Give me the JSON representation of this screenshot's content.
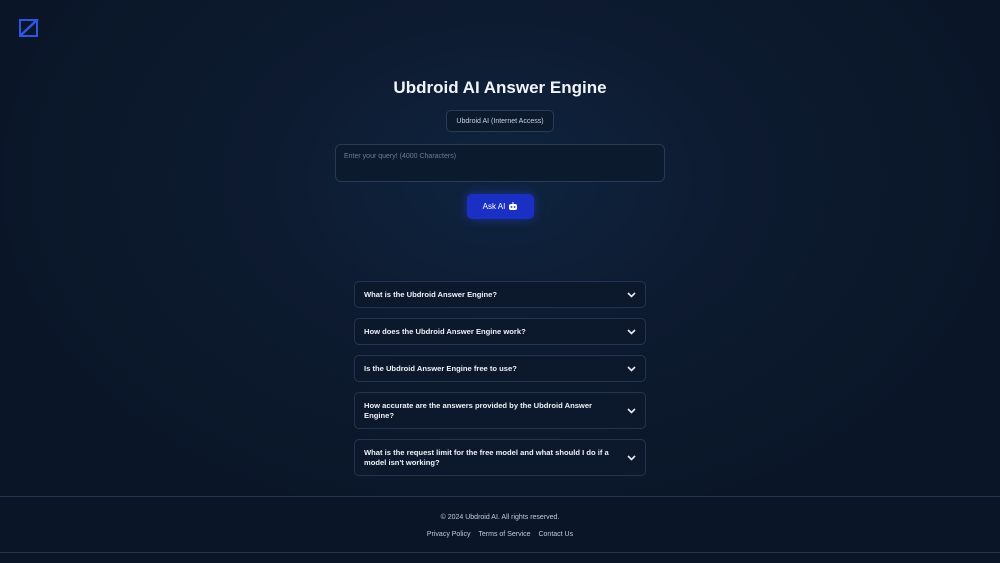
{
  "header": {
    "logo_icon": "logo-icon",
    "title": "Ubdroid AI Answer Engine"
  },
  "form": {
    "model_selected": "Ubdroid AI (Internet Access)",
    "query_placeholder": "Enter your query! (4000 Characters)",
    "ask_label": "Ask AI",
    "ask_icon": "robot-icon",
    "accent_color": "#1a2fc4"
  },
  "faq": [
    {
      "question": "What is the Ubdroid Answer Engine?"
    },
    {
      "question": "How does the Ubdroid Answer Engine work?"
    },
    {
      "question": "Is the Ubdroid Answer Engine free to use?"
    },
    {
      "question": "How accurate are the answers provided by the Ubdroid Answer Engine?"
    },
    {
      "question": "What is the request limit for the free model and what should I do if a model isn't working?"
    }
  ],
  "footer": {
    "copyright": "© 2024 Ubdroid AI. All rights reserved.",
    "links": [
      "Privacy Policy",
      "Terms of Service",
      "Contact Us"
    ]
  }
}
